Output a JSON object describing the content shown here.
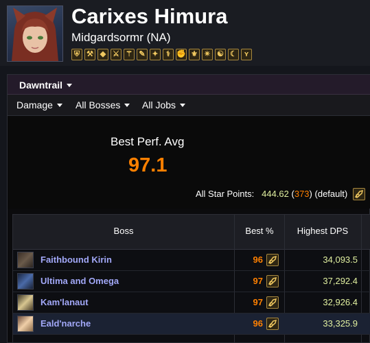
{
  "header": {
    "character_name": "Carixes Himura",
    "server": "Midgardsormr (NA)",
    "job_icons": [
      "paladin-icon",
      "warrior-icon",
      "darkknight-icon",
      "gunbreaker-icon",
      "whitemage-icon",
      "scholar-icon",
      "astrologian-icon",
      "sage-icon",
      "monk-icon",
      "dragoon-icon",
      "ninja-icon",
      "samurai-icon",
      "reaper-icon",
      "viper-icon"
    ]
  },
  "filters": {
    "expansion": "Dawntrail",
    "metric": "Damage",
    "bosses": "All Bosses",
    "jobs": "All Jobs"
  },
  "summary": {
    "best_perf_label": "Best Perf. Avg",
    "best_perf_value": "97.1",
    "all_star_label": "All Star Points:",
    "all_star_points": "444.62",
    "all_star_rank_open": "(",
    "all_star_rank": "373",
    "all_star_rank_close": ")",
    "all_star_mode": "(default)"
  },
  "table": {
    "headers": {
      "boss": "Boss",
      "best": "Best %",
      "dps": "Highest DPS"
    },
    "rows": [
      {
        "boss": "Faithbound Kirin",
        "best": "96",
        "dps": "34,093.5",
        "icon": "kirin-icon"
      },
      {
        "boss": "Ultima and Omega",
        "best": "97",
        "dps": "37,292.4",
        "icon": "ultima-omega-icon"
      },
      {
        "boss": "Kam'lanaut",
        "best": "97",
        "dps": "32,926.4",
        "icon": "kamlanaut-icon"
      },
      {
        "boss": "Eald'narche",
        "best": "96",
        "dps": "33,325.9",
        "icon": "ealdnarche-icon"
      }
    ]
  },
  "colors": {
    "accent_orange": "#ff8000",
    "boss_link": "#a2a8f8",
    "dps_text": "#e1f0a0",
    "icon_gold": "#f0c860"
  }
}
